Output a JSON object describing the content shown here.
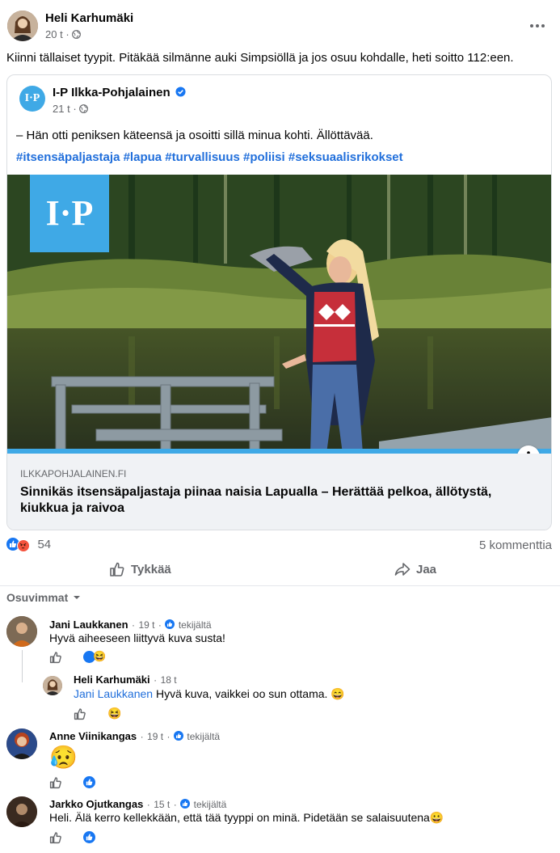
{
  "post": {
    "author": "Heli Karhumäki",
    "time": "20 t",
    "dot": "·",
    "text": "Kiinni tällaiset tyypit. Pitäkää silmänne auki Simpsiöllä ja jos osuu kohdalle, heti soitto 112:een.",
    "more_icon": "more-horizontal-icon"
  },
  "shared": {
    "page_name": "I-P Ilkka-Pohjalainen",
    "avatar_text": "I·P",
    "time": "21 t",
    "dot": "·",
    "quote": "– Hän otti peniksen käteensä ja osoitti sillä minua kohti. Ällöttävää.",
    "hashtags": [
      "#itsensäpaljastaja",
      "#lapua",
      "#turvallisuus",
      "#poliisi",
      "#seksuaalisrikokset"
    ],
    "logo_text": "I·P",
    "domain": "ILKKAPOHJALAINEN.FI",
    "headline": "Sinnikäs itsensäpaljastaja piinaa naisia Lapualla – Herättää pelkoa, ällötystä, kiukkua ja raivoa",
    "info_icon": "info-icon"
  },
  "stats": {
    "reaction_count": "54",
    "comments": "5 kommenttia"
  },
  "actions": {
    "like": "Tykkää",
    "share": "Jaa"
  },
  "sort": {
    "label": "Osuvimmat"
  },
  "comments": [
    {
      "name": "Jani Laukkanen",
      "time": "19 t",
      "dot": "·",
      "badge": "tekijältä",
      "text": "Hyvä aiheeseen liittyvä kuva susta!",
      "emoji": ""
    },
    {
      "name": "Heli Karhumäki",
      "time": "18 t",
      "dot": "·",
      "mention": "Jani Laukkanen",
      "text": " Hyvä kuva, vaikkei oo sun ottama. ",
      "emoji": "😄"
    },
    {
      "name": "Anne Viinikangas",
      "time": "19 t",
      "dot": "·",
      "badge": "tekijältä",
      "emoji": "😥"
    },
    {
      "name": "Jarkko Ojutkangas",
      "time": "15 t",
      "dot": "·",
      "badge": "tekijältä",
      "text": "Heli. Älä kerro kellekkään, että tää tyyppi on minä. Pidetään se salaisuutena",
      "emoji": "😀"
    }
  ],
  "colors": {
    "accent": "#216fdb",
    "like_blue": "#1877f2",
    "angry": "#f5533d",
    "logo_blue": "#3fa9e6"
  }
}
